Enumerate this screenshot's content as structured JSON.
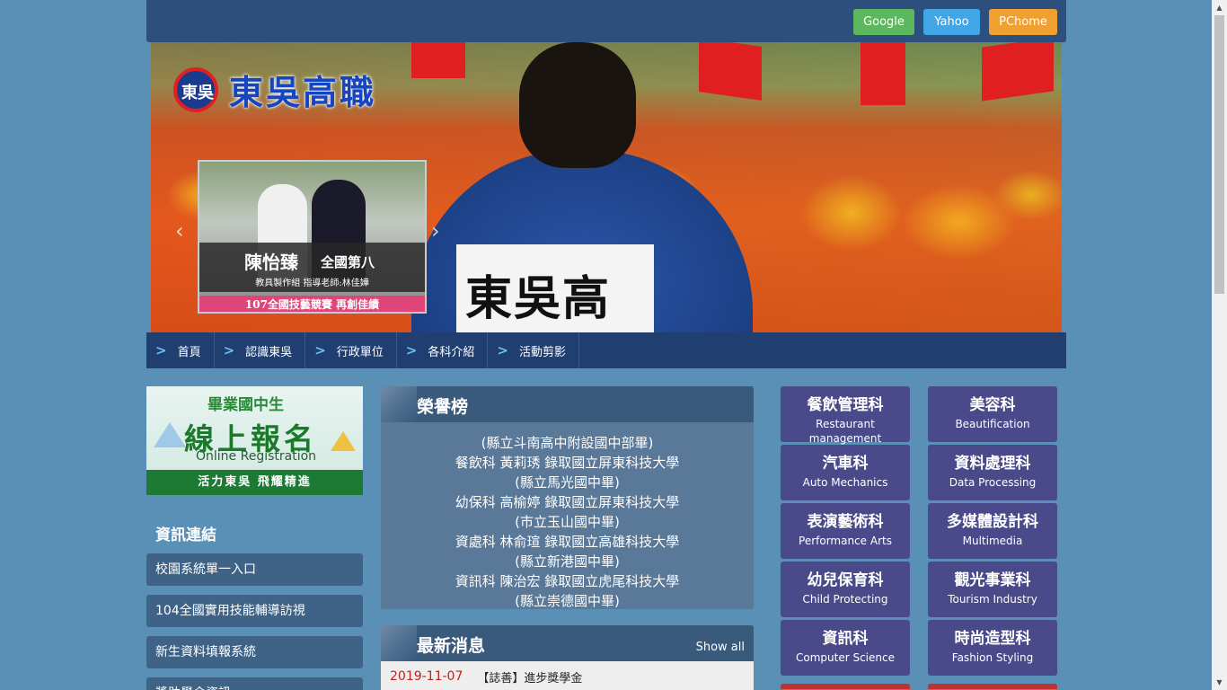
{
  "topbar": {
    "buttons": [
      "Google",
      "Yahoo",
      "PChome"
    ],
    "colors": {
      "google": "#5cb85c",
      "yahoo": "#42a5e6",
      "pchome": "#f0a030"
    }
  },
  "banner": {
    "school_name": "東吳高職",
    "emblem_text": "東吳",
    "jacket_text": "東吳高職",
    "slide": {
      "name": "陳怡臻",
      "rank": "全國第八",
      "subtitle": "教具製作組 指導老師:林佳嬅",
      "footer": "107全國技藝競賽 再創佳績"
    }
  },
  "nav": {
    "items": [
      "首頁",
      "認識東吳",
      "行政單位",
      "各科介紹",
      "活動剪影"
    ]
  },
  "registration": {
    "top": "畢業國中生",
    "main": "線上報名",
    "english": "Online Registration",
    "footer": "活力東吳 飛耀精進"
  },
  "links": {
    "title": "資訊連結",
    "items": [
      "校園系統單一入口",
      "104全國實用技能輔導訪視",
      "新生資料填報系統",
      "獎助學金資訊"
    ]
  },
  "honor": {
    "title": "榮譽榜",
    "lines": [
      "(縣立斗南高中附設國中部畢)",
      "餐飲科 黃莉琇 錄取國立屏東科技大學",
      "(縣立馬光國中畢)",
      "幼保科 高榆婷 錄取國立屏東科技大學",
      "(市立玉山國中畢)",
      "資處科 林俞瑄 錄取國立高雄科技大學",
      "(縣立新港國中畢)",
      "資訊科 陳治宏 錄取國立虎尾科技大學",
      "(縣立崇德國中畢)"
    ]
  },
  "news": {
    "title": "最新消息",
    "show_all": "Show all",
    "items": [
      {
        "date": "2019-11-07",
        "text": "【誌善】進步獎學金"
      }
    ]
  },
  "departments": [
    {
      "zh": "餐飲管理科",
      "en": "Restaurant management"
    },
    {
      "zh": "美容科",
      "en": "Beautification"
    },
    {
      "zh": "汽車科",
      "en": "Auto Mechanics"
    },
    {
      "zh": "資料處理科",
      "en": "Data Processing"
    },
    {
      "zh": "表演藝術科",
      "en": "Performance Arts"
    },
    {
      "zh": "多媒體設計科",
      "en": "Multimedia"
    },
    {
      "zh": "幼兒保育科",
      "en": "Child Protecting"
    },
    {
      "zh": "觀光事業科",
      "en": "Tourism Industry"
    },
    {
      "zh": "資訊科",
      "en": "Computer Science"
    },
    {
      "zh": "時尚造型科",
      "en": "Fashion Styling"
    }
  ]
}
